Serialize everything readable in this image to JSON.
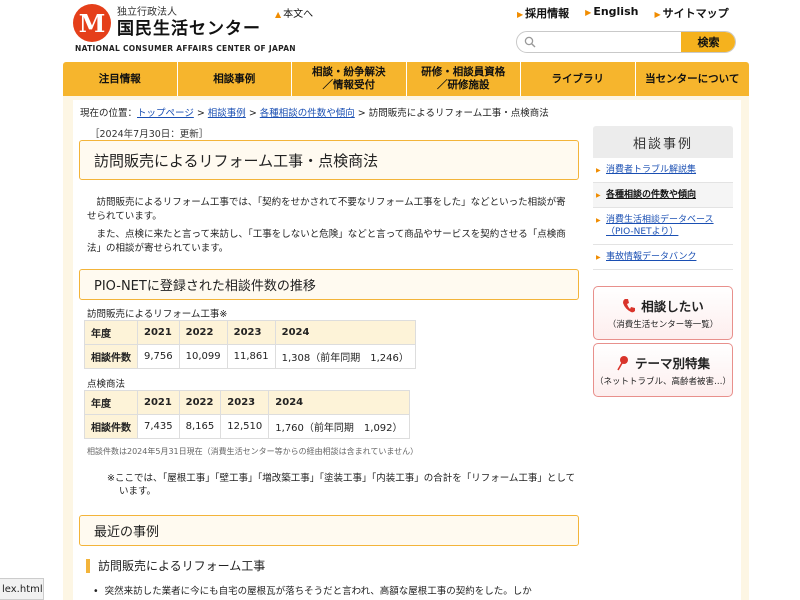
{
  "header": {
    "org_small": "独立行政法人",
    "org_name": "国民生活センター",
    "org_en": "NATIONAL CONSUMER AFFAIRS CENTER OF JAPAN",
    "logo_glyph": "M",
    "skip_link": "本文へ",
    "top_links": [
      "採用情報",
      "English",
      "サイトマップ"
    ],
    "search_placeholder": "",
    "search_button": "検索"
  },
  "nav": {
    "items": [
      "注目情報",
      "相談事例",
      "相談・紛争解決\n／情報受付",
      "研修・相談員資格\n／研修施設",
      "ライブラリ",
      "当センターについて"
    ]
  },
  "breadcrumb": {
    "prefix": "現在の位置：",
    "items": [
      "トップページ",
      "相談事例",
      "各種相談の件数や傾向"
    ],
    "current": "訪問販売によるリフォーム工事・点検商法"
  },
  "article": {
    "date": "［2024年7月30日：更新］",
    "title": "訪問販売によるリフォーム工事・点検商法",
    "p1": "訪問販売によるリフォーム工事では、「契約をせかされて不要なリフォーム工事をした」などといった相談が寄せられています。",
    "p2": "また、点検に来たと言って来訪し、「工事をしないと危険」などと言って商品やサービスを契約させる「点検商法」の相談が寄せられています。",
    "pio_heading": "PIO-NETに登録された相談件数の推移",
    "table1": {
      "caption": "訪問販売によるリフォーム工事※",
      "header": [
        "年度",
        "2021",
        "2022",
        "2023",
        "2024"
      ],
      "row_label": "相談件数",
      "values": [
        "9,756",
        "10,099",
        "11,861",
        "1,308（前年同期　1,246）"
      ]
    },
    "table2": {
      "caption": "点検商法",
      "header": [
        "年度",
        "2021",
        "2022",
        "2023",
        "2024"
      ],
      "row_label": "相談件数",
      "values": [
        "7,435",
        "8,165",
        "12,510",
        "1,760（前年同期　1,092）"
      ]
    },
    "note_small": "相談件数は2024年5月31日現在（消費生活センター等からの経由相談は含まれていません）",
    "note2": "※ここでは、「屋根工事」「壁工事」「増改築工事」「塗装工事」「内装工事」の合計を「リフォーム工事」としています。",
    "recent_heading": "最近の事例",
    "sub_heading": "訪問販売によるリフォーム工事",
    "bullet1": "突然来訪した業者に今にも自宅の屋根瓦が落ちそうだと言われ、高額な屋根工事の契約をした。しか"
  },
  "sidebar": {
    "heading": "相談事例",
    "items": [
      "消費者トラブル解説集",
      "各種相談の件数や傾向",
      "消費生活相談データベース（PIO-NETより）",
      "事故情報データバンク"
    ],
    "btn1": {
      "main": "相談したい",
      "sub": "（消費生活センター等一覧）"
    },
    "btn2": {
      "main": "テーマ別特集",
      "sub": "（ネットトラブル、高齢者被害…）"
    }
  },
  "status": {
    "tab_text": "lex.html"
  }
}
